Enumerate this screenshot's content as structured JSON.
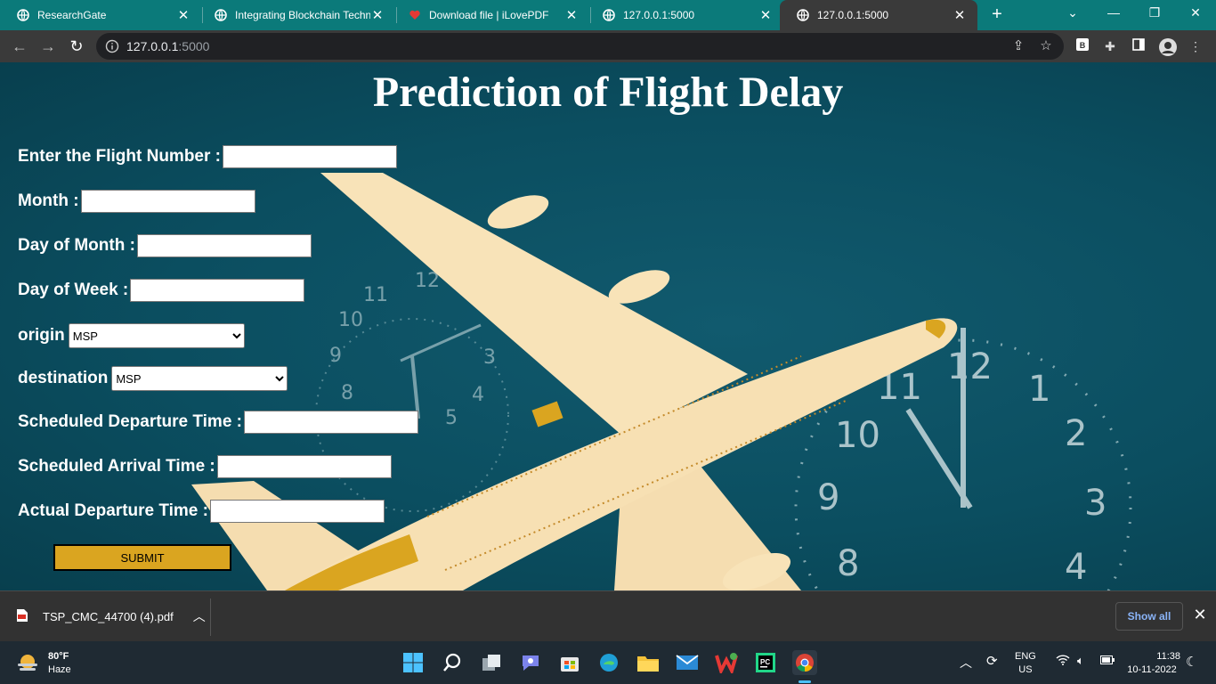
{
  "browser": {
    "tabs": [
      {
        "label": "ResearchGate",
        "icon": "globe-icon",
        "active": false
      },
      {
        "label": "Integrating Blockchain Techn",
        "icon": "globe-icon",
        "active": false
      },
      {
        "label": "Download file | iLovePDF",
        "icon": "heart-icon",
        "active": false
      },
      {
        "label": "127.0.0.1:5000",
        "icon": "globe-icon",
        "active": false
      },
      {
        "label": "127.0.0.1:5000",
        "icon": "globe-icon",
        "active": true
      }
    ],
    "new_tab": "+",
    "address": {
      "host": "127.0.0.1",
      "port": ":5000"
    }
  },
  "page": {
    "title": "Prediction of Flight Delay",
    "fields": {
      "flight_number": "Enter the Flight Number :",
      "month": "Month :",
      "day_of_month": "Day of Month :",
      "day_of_week": "Day of Week :",
      "origin": "origin",
      "destination": "destination",
      "sched_dep": "Scheduled Departure Time :",
      "sched_arr": "Scheduled Arrival Time :",
      "actual_dep": "Actual Departure Time :"
    },
    "origin_value": "MSP",
    "destination_value": "MSP",
    "submit": "SUBMIT"
  },
  "downloads": {
    "file": "TSP_CMC_44700 (4).pdf",
    "show_all": "Show all"
  },
  "taskbar": {
    "weather_temp": "80°F",
    "weather_desc": "Haze",
    "lang": "ENG",
    "region": "US",
    "time": "11:38",
    "date": "10-11-2022"
  },
  "colors": {
    "tabbar": "#0b7a7a",
    "page_bg": "#0b4e60",
    "submit_bg": "#daa520"
  }
}
